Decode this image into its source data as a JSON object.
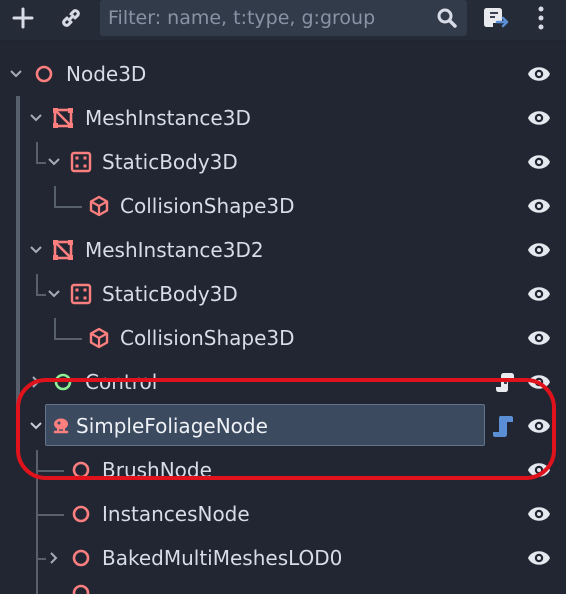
{
  "toolbar": {
    "add_node_icon": "plus-icon",
    "instantiate_scene_icon": "link-icon",
    "filter_placeholder": "Filter: name, t:type, g:group",
    "filter_value": "",
    "search_icon": "search-icon",
    "remote_script_icon": "script-attach-icon",
    "menu_icon": "vertical-ellipsis-icon"
  },
  "colors": {
    "node_red": "#fc7f7f",
    "control_green": "#8eef97",
    "selected_bg": "#3b4a5e",
    "highlight_ring": "#e0121b",
    "script_blue": "#5a8fd6"
  },
  "tree": {
    "nodes": [
      {
        "name": "Node3D",
        "icon": "node3d-icon",
        "expanded": true
      },
      {
        "name": "MeshInstance3D",
        "icon": "mesh-instance-icon",
        "expanded": true
      },
      {
        "name": "StaticBody3D",
        "icon": "static-body-icon",
        "expanded": true
      },
      {
        "name": "CollisionShape3D",
        "icon": "collision-shape-icon"
      },
      {
        "name": "MeshInstance3D2",
        "icon": "mesh-instance-icon",
        "expanded": true
      },
      {
        "name": "StaticBody3D",
        "icon": "static-body-icon",
        "expanded": true
      },
      {
        "name": "CollisionShape3D",
        "icon": "collision-shape-icon"
      },
      {
        "name": "Control",
        "icon": "control-icon",
        "expanded": false,
        "has_script": true
      },
      {
        "name": "SimpleFoliageNode",
        "icon": "foliage-icon",
        "expanded": true,
        "selected": true,
        "has_script": true
      },
      {
        "name": "BrushNode",
        "icon": "node3d-icon"
      },
      {
        "name": "InstancesNode",
        "icon": "node3d-icon"
      },
      {
        "name": "BakedMultiMeshesLOD0",
        "icon": "node3d-icon",
        "expanded": false
      }
    ]
  }
}
